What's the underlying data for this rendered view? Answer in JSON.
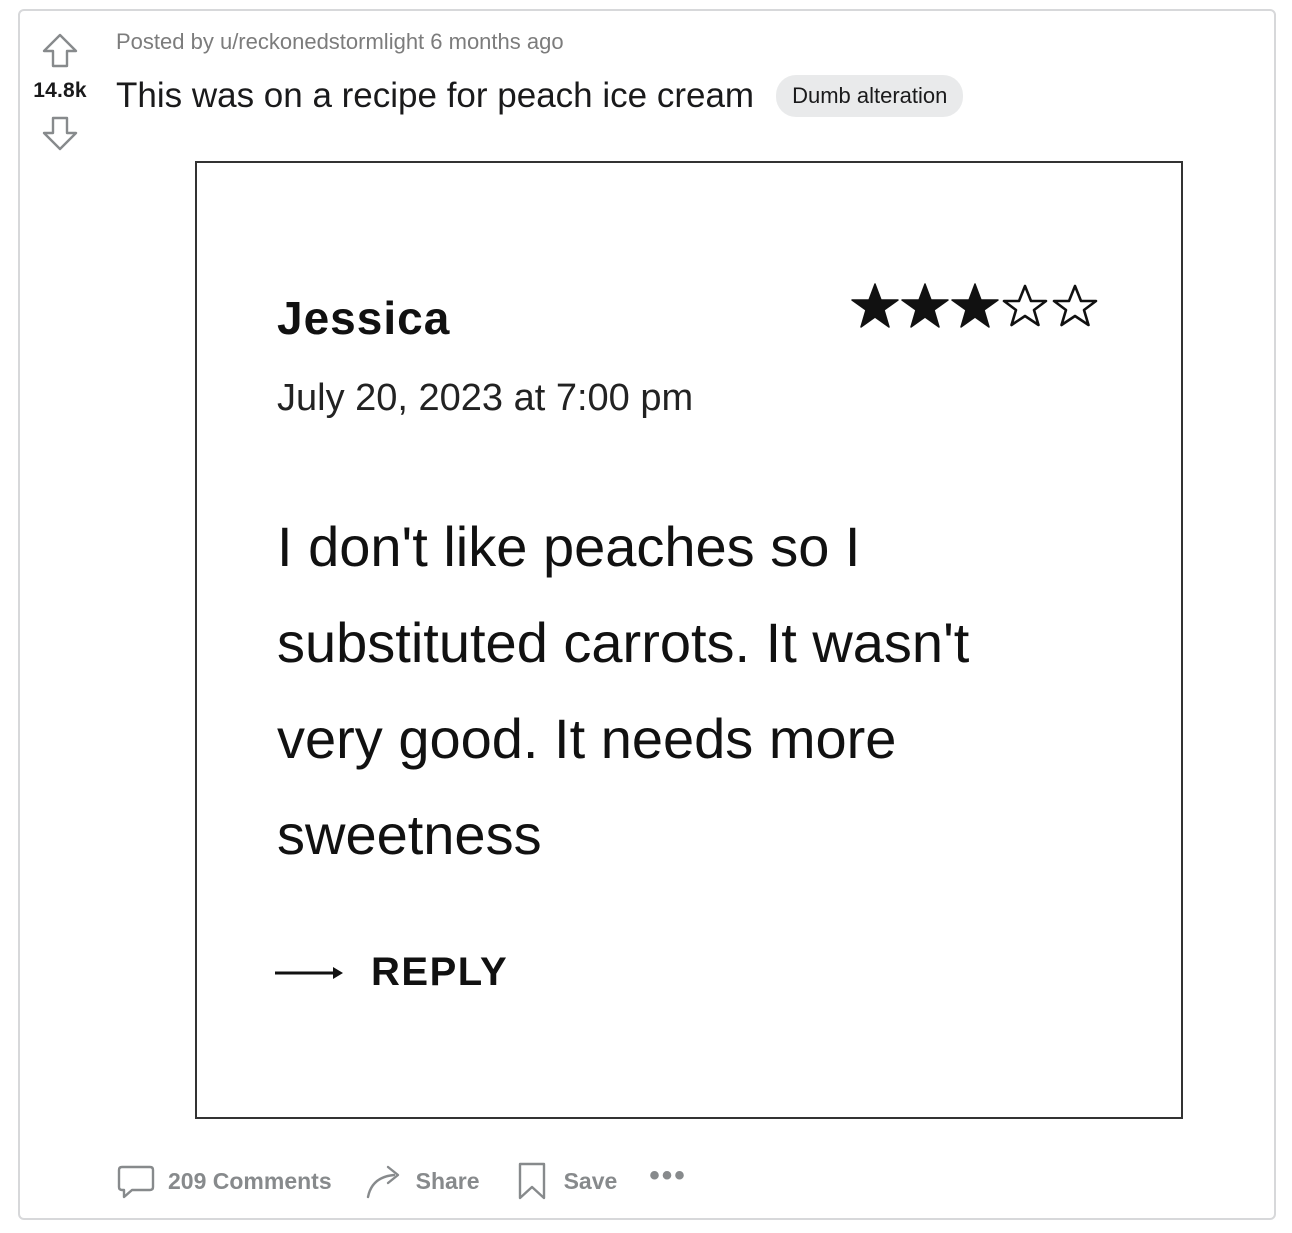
{
  "post": {
    "meta": "Posted by u/reckonedstormlight 6 months ago",
    "title": "This was on a recipe for peach ice cream",
    "flair": "Dumb alteration",
    "score": "14.8k"
  },
  "image": {
    "author": "Jessica",
    "rating": 3,
    "rating_max": 5,
    "date": "July 20, 2023 at 7:00 pm",
    "review": "I don't like peaches so I substituted carrots. It wasn't very good. It needs more sweetness",
    "reply_label": "REPLY"
  },
  "actions": {
    "comments": "209 Comments",
    "share": "Share",
    "save": "Save",
    "more": "•••"
  },
  "colors": {
    "border": "#d7d8da",
    "muted_text": "#878a8c",
    "flair_bg": "#e9eaeb"
  }
}
